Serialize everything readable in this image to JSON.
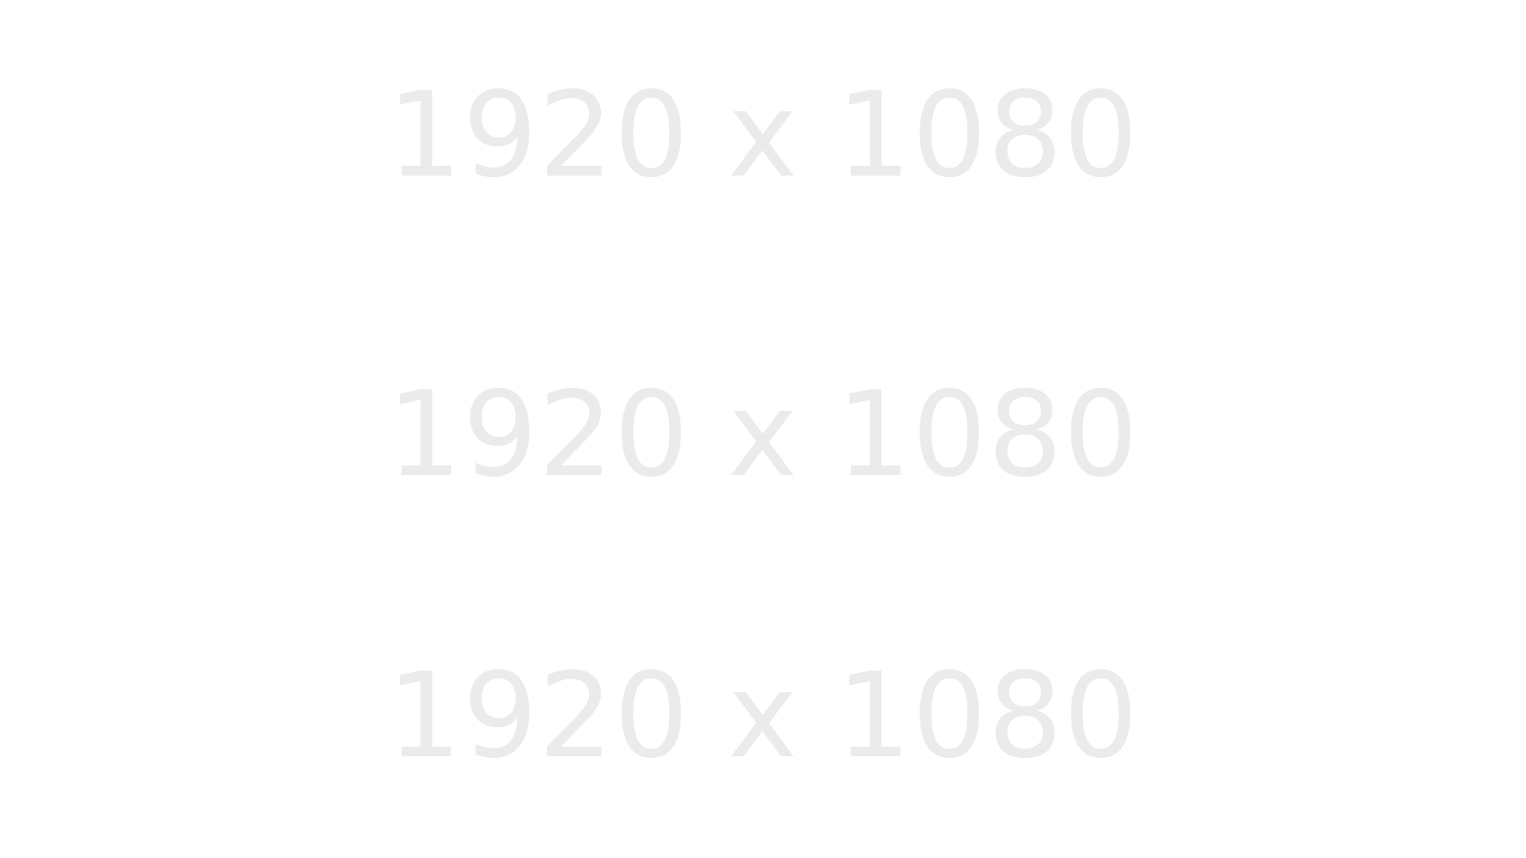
{
  "placeholder": {
    "lines": [
      "1920 x 1080",
      "1920 x 1080",
      "1920 x 1080"
    ],
    "text_color": "#ebebeb",
    "background_color": "#ffffff"
  }
}
